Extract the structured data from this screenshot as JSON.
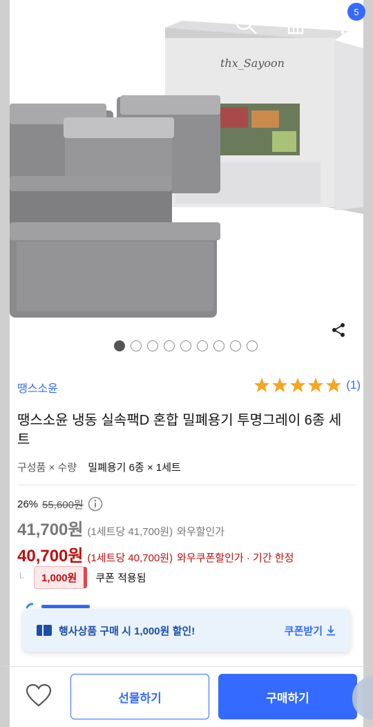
{
  "topbar": {
    "back_icon": "chevron-left-icon",
    "search_icon": "search-icon",
    "home_icon": "home-icon",
    "cart_icon": "cart-icon",
    "cart_count": "5"
  },
  "hero": {
    "box_text": "thx_Sayoon",
    "share_icon": "share-icon",
    "carousel": {
      "total": 9,
      "active": 1
    }
  },
  "product": {
    "brand": "땡스소윤",
    "rating_stars": 5,
    "review_count": "(1)",
    "title": "땡스소윤 냉동 실속팩D 혼합 밀폐용기 투명그레이 6종 세트",
    "option_label": "구성품 × 수량",
    "option_value": "밀폐용기 6종 × 1세트"
  },
  "price": {
    "discount": "26%",
    "original": "55,600원",
    "wow_price": "41,700원",
    "wow_unit": "(1세트당 41,700원)",
    "wow_label": "와우할인가",
    "coupon_price": "40,700원",
    "coupon_unit": "(1세트당 40,700원)",
    "coupon_label": "와우쿠폰할인가 · 기간 한정",
    "coupon_amount": "1,000원",
    "coupon_applied": "쿠폰 적용됨"
  },
  "promo": {
    "text": "행사상품 구매 시 1,000원 할인!",
    "link": "쿠폰받기"
  },
  "bottom": {
    "gift_label": "선물하기",
    "buy_label": "구매하기"
  },
  "colors": {
    "accent": "#346aff",
    "sale_red": "#c00d0d",
    "star": "#f5a623"
  }
}
